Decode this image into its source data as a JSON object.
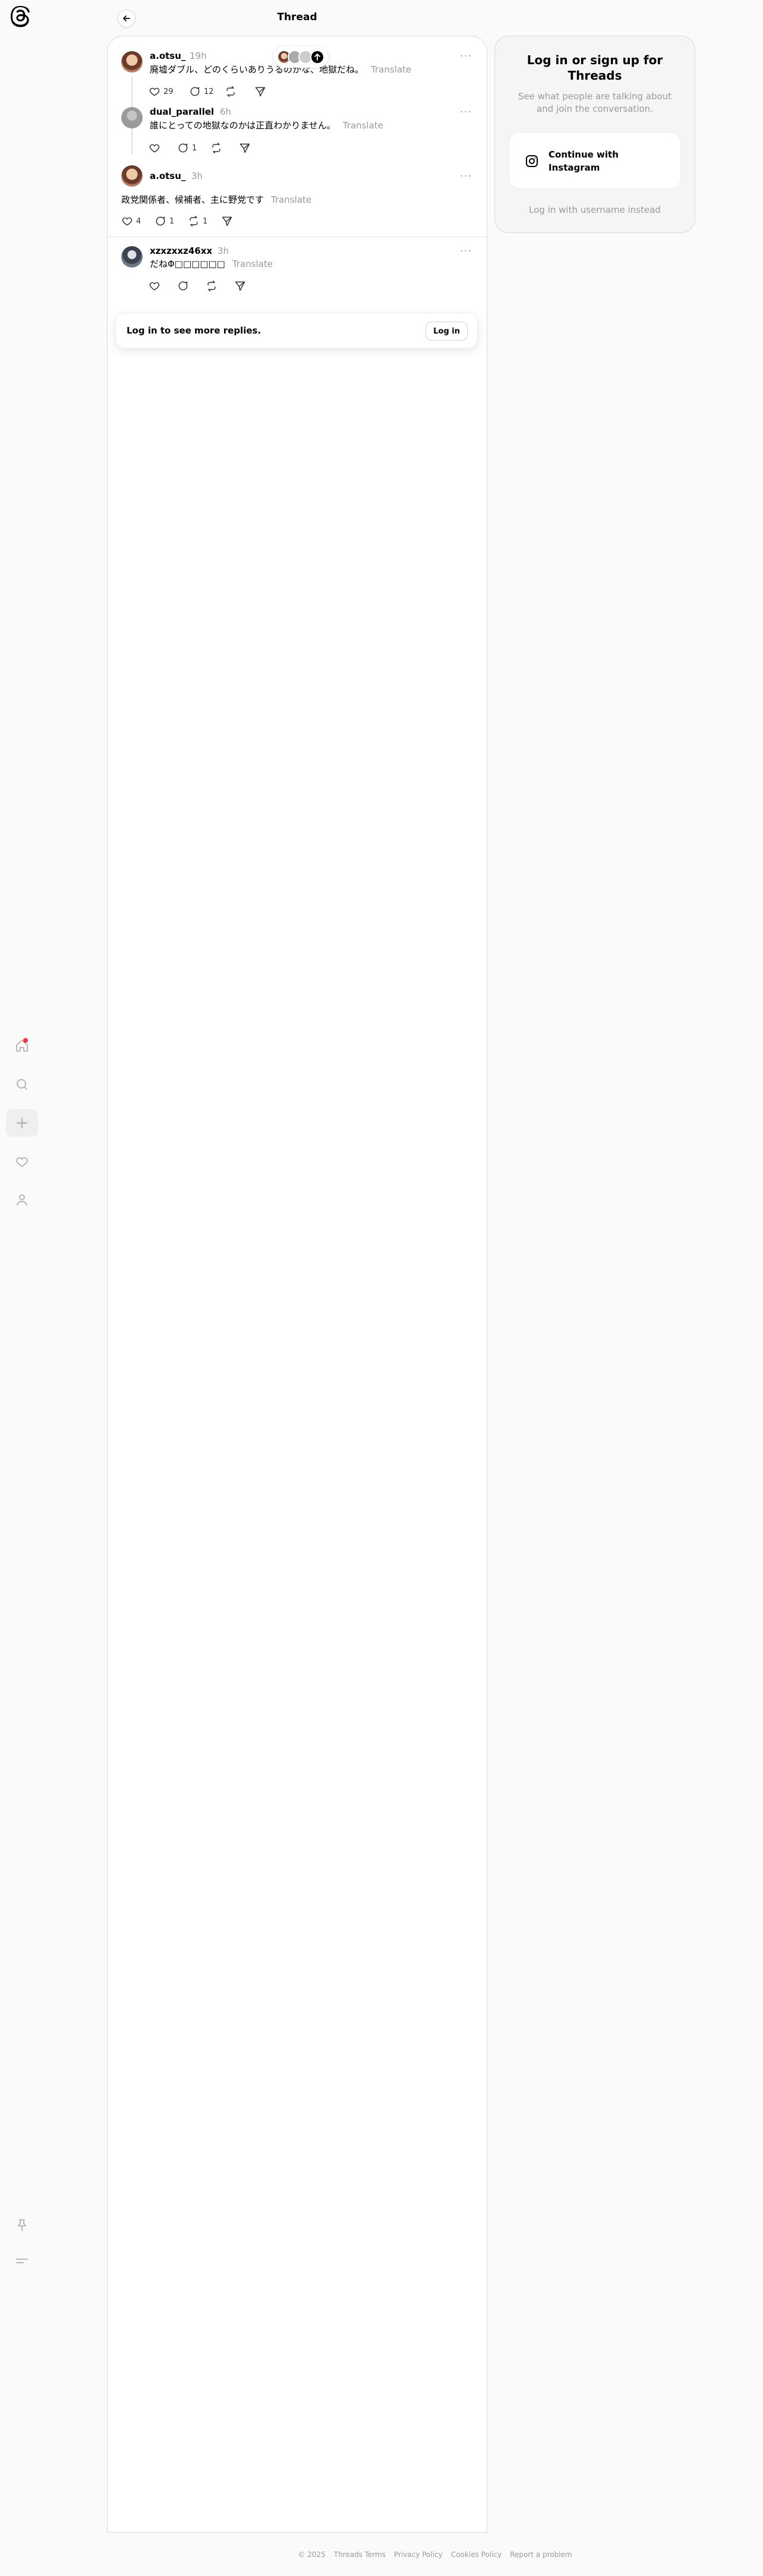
{
  "header": {
    "title": "Thread",
    "back_icon": "arrow-left-icon"
  },
  "nav": {
    "logo_icon": "threads-logo-icon",
    "items": [
      {
        "icon": "home-icon",
        "has_notification": true
      },
      {
        "icon": "search-icon"
      },
      {
        "icon": "plus-icon",
        "active": true
      },
      {
        "icon": "heart-icon"
      },
      {
        "icon": "profile-icon"
      }
    ],
    "bottom_items": [
      {
        "icon": "pin-icon"
      },
      {
        "icon": "menu-icon"
      }
    ]
  },
  "posts": [
    {
      "username": "a.otsu_",
      "time": "19h",
      "text": "廃墟ダブル、どのくらいありうるのかな、地獄だね。",
      "translate": "Translate",
      "likes": "29",
      "replies": "12",
      "reposts": "",
      "more_label": "···"
    },
    {
      "username": "dual_parallel",
      "time": "6h",
      "text": "誰にとっての地獄なのかは正直わかりません。",
      "translate": "Translate",
      "likes": "",
      "replies": "1",
      "reposts": "",
      "more_label": "···"
    },
    {
      "username": "a.otsu_",
      "time": "3h",
      "text": "政党関係者、候補者、主に野党です",
      "translate": "Translate",
      "likes": "4",
      "replies": "1",
      "reposts": "1",
      "more_label": "···"
    },
    {
      "username": "xzxzxxz46xx",
      "time": "3h",
      "text": "だねΦ□□□□□□",
      "translate": "Translate",
      "likes": "",
      "replies": "",
      "reposts": "",
      "more_label": "···"
    }
  ],
  "login_banner": {
    "text": "Log in to see more replies.",
    "button": "Log in"
  },
  "side_card": {
    "title": "Log in or sign up for Threads",
    "subtitle": "See what people are talking about and join the conversation.",
    "instagram_button": "Continue with Instagram",
    "instagram_icon": "instagram-icon",
    "alt_login": "Log in with username instead"
  },
  "footer": {
    "links": [
      "© 2025",
      "Threads Terms",
      "Privacy Policy",
      "Cookies Policy",
      "Report a problem"
    ]
  },
  "colors": {
    "notification": "#ff3040",
    "muted": "#999999",
    "panel_bg": "#ffffff",
    "page_bg": "#fafafa"
  }
}
